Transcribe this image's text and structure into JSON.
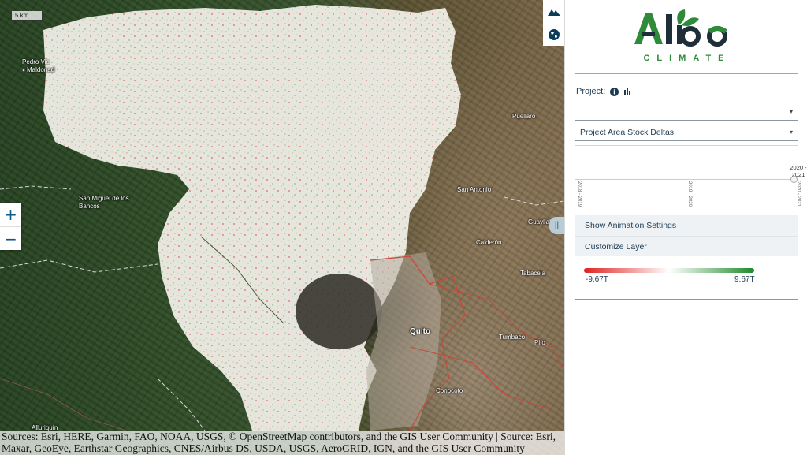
{
  "map": {
    "scale_label": "5 km",
    "places": [
      {
        "name": "Pedro Vicente\nMaldonado",
        "line1": "Pedro Vic",
        "line2": "Maldonad"
      },
      {
        "name": "San Miguel de los Bancos"
      },
      {
        "name": "Puellaro"
      },
      {
        "name": "San Antonio"
      },
      {
        "name": "Guayllab"
      },
      {
        "name": "Calderón"
      },
      {
        "name": "Tabacela"
      },
      {
        "name": "Quito"
      },
      {
        "name": "Tumbaco"
      },
      {
        "name": "Pifo"
      },
      {
        "name": "Conocoto"
      },
      {
        "name": "Alluriquín"
      }
    ],
    "zoom_in": "+",
    "zoom_out": "−",
    "tools": [
      {
        "icon": "mountain-icon"
      },
      {
        "icon": "globe-icon"
      }
    ],
    "collapse_handle": "||",
    "attribution": "Sources: Esri, HERE, Garmin, FAO, NOAA, USGS, © OpenStreetMap contributors, and the GIS User Community | Source: Esri, Maxar, GeoEye, Earthstar Geographics, CNES/Airbus DS, USDA, USGS, AeroGRID, IGN, and the GIS User Community"
  },
  "panel": {
    "logo_word": "Albo",
    "logo_sub": "CLIMATE",
    "brand_colors": {
      "green": "#2f8a3a",
      "dark": "#1f2f3a"
    },
    "project_label": "Project:",
    "project_select_value": "",
    "layer_select_value": "Project Area Stock Deltas",
    "timeline": {
      "ticks": [
        "2018 - 2019",
        "2019 - 2020",
        "2020 - 2021"
      ],
      "current_line1": "2020 -",
      "current_line2": "2021"
    },
    "show_animation_label": "Show Animation Settings",
    "customize_layer_label": "Customize Layer",
    "legend": {
      "min_label": "-9.67T",
      "max_label": "9.67T",
      "min_color": "#e02020",
      "mid_color": "#ffffff",
      "max_color": "#1e8a2a"
    }
  }
}
